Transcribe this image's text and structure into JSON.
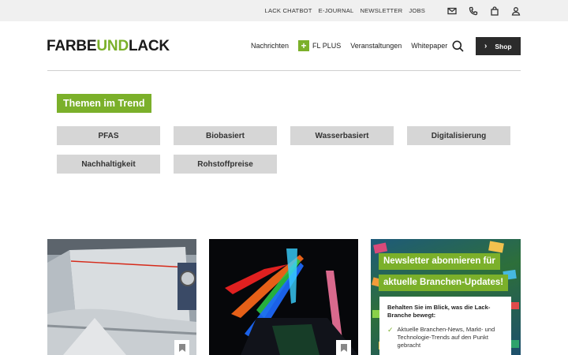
{
  "topbar": {
    "links": [
      "LACK CHATBOT",
      "E-JOURNAL",
      "NEWSLETTER",
      "JOBS"
    ],
    "icons": [
      "mail-icon",
      "phone-icon",
      "bag-icon",
      "user-icon"
    ]
  },
  "header": {
    "logo_part1": "FARBE",
    "logo_part2": "UND",
    "logo_part3": "LACK",
    "nav": {
      "nachrichten": "Nachrichten",
      "fl_plus_sign": "+",
      "fl_plus": "FL PLUS",
      "veranstaltungen": "Veranstaltungen",
      "whitepaper": "Whitepaper"
    },
    "shop_chevron": "›",
    "shop_label": "Shop"
  },
  "trends": {
    "title": "Themen im Trend",
    "tags": [
      "PFAS",
      "Biobasiert",
      "Wasserbasiert",
      "Digitalisierung",
      "Nachhaltigkeit",
      "Rohstoffpreise"
    ]
  },
  "newsletter": {
    "headline_line1": "Newsletter abonnieren für",
    "headline_line2": "aktuelle Branchen-Updates!",
    "lead": "Behalten Sie im Blick, was die Lack-Branche bewegt:",
    "check": "✓",
    "point1": "Aktuelle Branchen-News, Markt- und Technologie-Trends auf den Punkt gebracht"
  },
  "colors": {
    "accent_green": "#7bb02a",
    "tag_gray": "#d6d6d6",
    "topbar_gray": "#f0f0f0",
    "shop_dark": "#2b2b2b"
  }
}
